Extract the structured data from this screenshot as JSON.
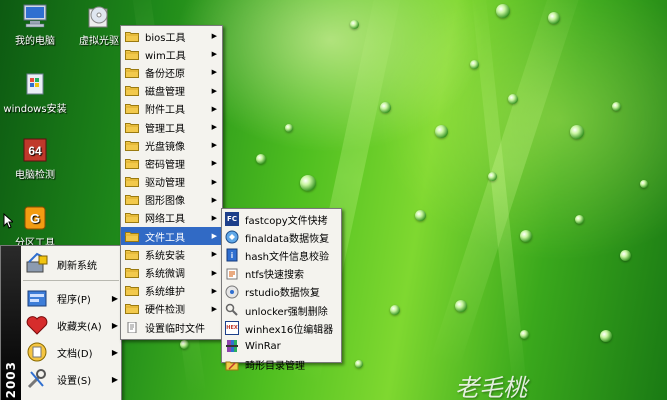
{
  "desktop": {
    "icons": [
      {
        "label": "我的电脑",
        "icon": "my-computer-icon"
      },
      {
        "label": "虚拟光驱",
        "icon": "virtual-drive-icon"
      },
      {
        "label": "windows安装",
        "icon": "windows-setup-icon"
      },
      {
        "label": "电脑检测",
        "icon": "pc-check-icon"
      },
      {
        "label": "分区工具",
        "icon": "partition-tool-icon"
      }
    ],
    "signature": "老毛桃"
  },
  "start_menu": {
    "band_text": "2003",
    "items": [
      {
        "label": "刷新系统",
        "icon": "refresh-icon",
        "arrow": ""
      },
      {
        "label": "程序(P)",
        "icon": "programs-icon",
        "arrow": "▶"
      },
      {
        "label": "收藏夹(A)",
        "icon": "favorites-icon",
        "arrow": "▶"
      },
      {
        "label": "文档(D)",
        "icon": "documents-icon",
        "arrow": "▶"
      },
      {
        "label": "设置(S)",
        "icon": "settings-icon",
        "arrow": "▶"
      }
    ]
  },
  "programs_menu": {
    "items": [
      {
        "label": "bios工具",
        "arrow": "▶"
      },
      {
        "label": "wim工具",
        "arrow": "▶"
      },
      {
        "label": "备份还原",
        "arrow": "▶"
      },
      {
        "label": "磁盘管理",
        "arrow": "▶"
      },
      {
        "label": "附件工具",
        "arrow": "▶"
      },
      {
        "label": "管理工具",
        "arrow": "▶"
      },
      {
        "label": "光盘镜像",
        "arrow": "▶"
      },
      {
        "label": "密码管理",
        "arrow": "▶"
      },
      {
        "label": "驱动管理",
        "arrow": "▶"
      },
      {
        "label": "图形图像",
        "arrow": "▶"
      },
      {
        "label": "网络工具",
        "arrow": "▶"
      },
      {
        "label": "文件工具",
        "arrow": "▶"
      },
      {
        "label": "系统安装",
        "arrow": "▶"
      },
      {
        "label": "系统微调",
        "arrow": "▶"
      },
      {
        "label": "系统维护",
        "arrow": "▶"
      },
      {
        "label": "硬件检测",
        "arrow": "▶"
      },
      {
        "label": "设置临时文件",
        "arrow": ""
      }
    ],
    "selected_index": 11
  },
  "file_tools_menu": {
    "items": [
      {
        "label": "fastcopy文件快拷",
        "icon": "fastcopy-icon",
        "badge": "FC"
      },
      {
        "label": "finaldata数据恢复",
        "icon": "finaldata-icon",
        "badge": ""
      },
      {
        "label": "hash文件信息校验",
        "icon": "hash-icon",
        "badge": ""
      },
      {
        "label": "ntfs快速搜索",
        "icon": "ntfs-search-icon",
        "badge": ""
      },
      {
        "label": "rstudio数据恢复",
        "icon": "rstudio-icon",
        "badge": ""
      },
      {
        "label": "unlocker强制删除",
        "icon": "unlocker-icon",
        "badge": ""
      },
      {
        "label": "winhex16位编辑器",
        "icon": "winhex-icon",
        "badge": "HEX"
      },
      {
        "label": "WinRar",
        "icon": "winrar-icon",
        "badge": ""
      },
      {
        "label": "畸形目录管理",
        "icon": "folder-manage-icon",
        "badge": ""
      }
    ]
  },
  "colors": {
    "menu_bg": "#f4f3ee",
    "selection": "#316ac5",
    "folder": "#f2c94c"
  }
}
